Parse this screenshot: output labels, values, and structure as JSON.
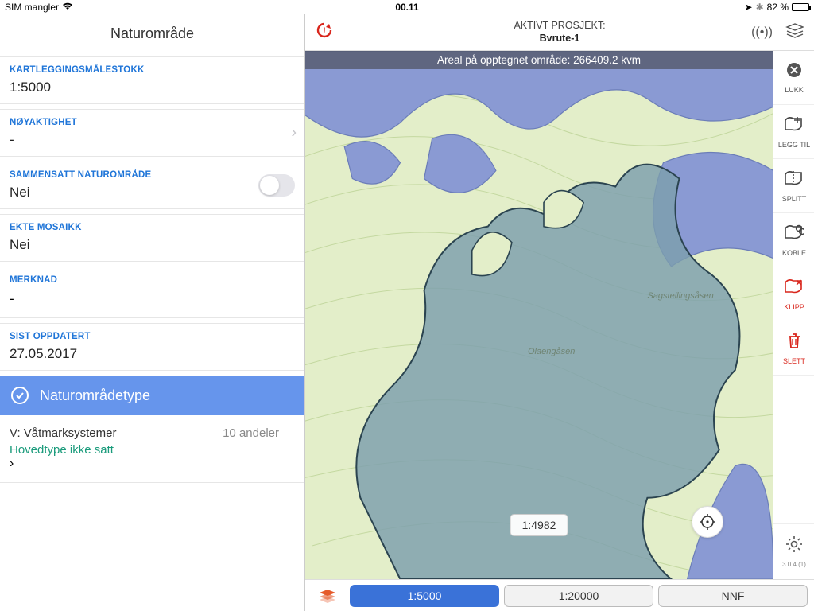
{
  "status": {
    "sim": "SIM mangler",
    "time": "00.11",
    "battery_pct": "82 %"
  },
  "header": {
    "project_label": "AKTIVT PROSJEKT:",
    "project_name": "Bvrute-1"
  },
  "sidebar": {
    "title": "Naturområde",
    "scale": {
      "label": "KARTLEGGINGSMÅLESTOKK",
      "value": "1:5000"
    },
    "accuracy": {
      "label": "NØYAKTIGHET",
      "value": "-"
    },
    "composite": {
      "label": "SAMMENSATT NATUROMRÅDE",
      "value": "Nei"
    },
    "mosaic": {
      "label": "EKTE MOSAIKK",
      "value": "Nei"
    },
    "note": {
      "label": "MERKNAD",
      "value": "-"
    },
    "updated": {
      "label": "SIST OPPDATERT",
      "value": "27.05.2017"
    },
    "section_type": "Naturområdetype",
    "type_row": {
      "line1": "V: Våtmarksystemer",
      "line2": "Hovedtype ikke satt",
      "count": "10 andeler"
    }
  },
  "map": {
    "area_text": "Areal på opptegnet område: 266409.2 kvm",
    "scale_readout": "1:4982",
    "labels": {
      "a": "Olaengåsen",
      "b": "Sagstellingsåsen"
    }
  },
  "tools": {
    "close": "LUKK",
    "add": "LEGG TIL",
    "split": "SPLITT",
    "link": "KOBLE",
    "clip": "KLIPP",
    "delete": "SLETT",
    "version": "3.0.4 (1)"
  },
  "bottom": {
    "b1": "1:5000",
    "b2": "1:20000",
    "b3": "NNF"
  }
}
